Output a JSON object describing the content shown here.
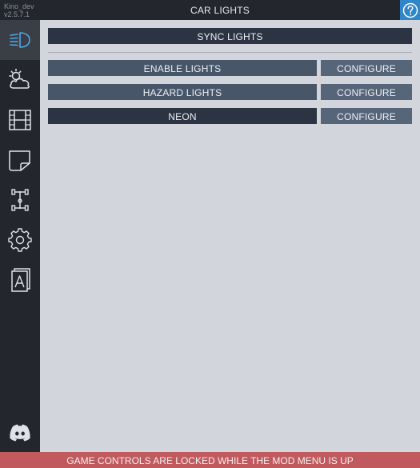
{
  "header": {
    "mod_name": "Kino_dev",
    "version": "v2.5.7.1",
    "title": "CAR LIGHTS",
    "help_icon": "question-circle-icon"
  },
  "sidebar": {
    "items": [
      {
        "icon": "headlights-icon",
        "active": true
      },
      {
        "icon": "weather-icon",
        "active": false
      },
      {
        "icon": "film-strip-icon",
        "active": false
      },
      {
        "icon": "note-icon",
        "active": false
      },
      {
        "icon": "chassis-icon",
        "active": false
      },
      {
        "icon": "gear-icon",
        "active": false
      },
      {
        "icon": "font-file-icon",
        "active": false
      }
    ],
    "bottom_icon": "discord-icon"
  },
  "main": {
    "sync_label": "SYNC LIGHTS",
    "rows": [
      {
        "label": "ENABLE LIGHTS",
        "configure_label": "CONFIGURE"
      },
      {
        "label": "HAZARD LIGHTS",
        "configure_label": "CONFIGURE"
      },
      {
        "label": "NEON",
        "configure_label": "CONFIGURE"
      }
    ]
  },
  "footer": {
    "message": "GAME CONTROLS ARE LOCKED WHILE THE MOD MENU IS UP"
  },
  "colors": {
    "accent": "#2f86c9",
    "panel_bg": "#d2d5dc",
    "sidebar_bg": "#23262c",
    "footer_bg": "#c05a5e"
  }
}
